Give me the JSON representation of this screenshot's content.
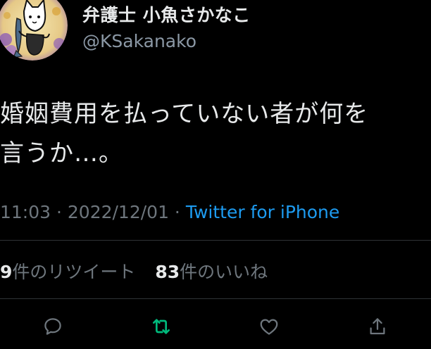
{
  "user": {
    "display_name": "弁護士 小魚さかなこ",
    "handle": "@KSakanako"
  },
  "tweet": {
    "text": "婚姻費用を払っていない者が何を\n言うか…。",
    "time": "11:03",
    "separator": " · ",
    "date": "2022/12/01",
    "source": "Twitter for iPhone"
  },
  "stats": {
    "retweets_count": "9",
    "retweets_label": "件のリツイート",
    "likes_count": "83",
    "likes_label": "件のいいね"
  },
  "actions": [
    {
      "name": "reply",
      "icon": "speech-bubble-icon"
    },
    {
      "name": "retweet",
      "icon": "retweet-arrows-icon"
    },
    {
      "name": "like",
      "icon": "heart-icon"
    },
    {
      "name": "share",
      "icon": "share-upload-icon"
    }
  ],
  "colors": {
    "background": "#000000",
    "text": "#e7e9ea",
    "muted": "#6e767d",
    "link": "#1d9bf0",
    "retweet_active": "#00ba7c",
    "divider": "#2f3336"
  }
}
